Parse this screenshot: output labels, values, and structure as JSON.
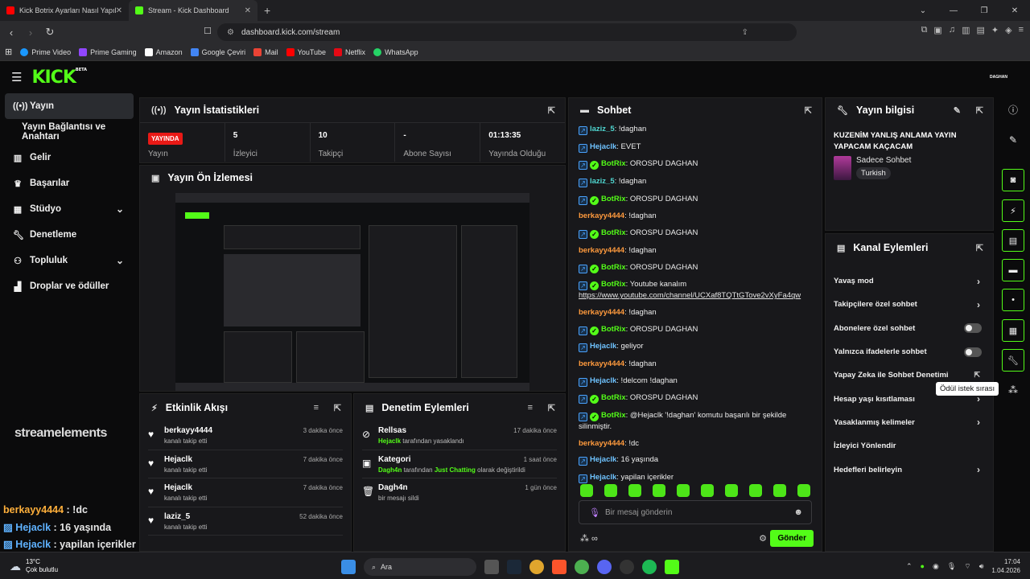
{
  "browser": {
    "tabs": [
      {
        "title": "Kick Botrix Ayarları Nasıl Yapılır? Takip",
        "favicon_color": "#ff0000"
      },
      {
        "title": "Stream - Kick Dashboard",
        "favicon_color": "#53fc18"
      }
    ],
    "url": "dashboard.kick.com/stream",
    "bookmarks": [
      "Prime Video",
      "Prime Gaming",
      "Amazon",
      "Google Çeviri",
      "Mail",
      "YouTube",
      "Netflix",
      "WhatsApp"
    ]
  },
  "header": {
    "logo": "KICK",
    "logo_badge": "BETA",
    "user": "DAGHAN"
  },
  "sidebar": {
    "items": [
      {
        "label": "Yayın",
        "icon": "broadcast-icon"
      },
      {
        "label": "Yayın Bağlantısı ve Anahtarı",
        "icon": ""
      },
      {
        "label": "Gelir",
        "icon": "chart-icon"
      },
      {
        "label": "Başarılar",
        "icon": "trophy-icon"
      },
      {
        "label": "Stüdyo",
        "icon": "studio-icon"
      },
      {
        "label": "Denetleme",
        "icon": "wrench-icon"
      },
      {
        "label": "Topluluk",
        "icon": "community-icon"
      },
      {
        "label": "Droplar ve ödüller",
        "icon": "gift-icon"
      }
    ],
    "watermark": "streamelements"
  },
  "overlay_chat": [
    {
      "user": "berkayy4444",
      "text": " : !dc"
    },
    {
      "user": "Hejaclk",
      "text": " : 16 yaşında"
    },
    {
      "user": "Hejaclk",
      "text": " : yapilan içerikler"
    }
  ],
  "stats": {
    "title": "Yayın İstatistikleri",
    "live": "YAYINDA",
    "live_label": "Yayın",
    "items": [
      {
        "value": "5",
        "label": "İzleyici"
      },
      {
        "value": "10",
        "label": "Takipçi"
      },
      {
        "value": "-",
        "label": "Abone Sayısı"
      },
      {
        "value": "01:13:35",
        "label": "Yayında Olduğu"
      }
    ]
  },
  "preview": {
    "title": "Yayın Ön İzlemesi"
  },
  "activity": {
    "title": "Etkinlik Akışı",
    "items": [
      {
        "user": "berkayy4444",
        "desc": "kanalı takip etti",
        "time": "3 dakika önce"
      },
      {
        "user": "Hejaclk",
        "desc": "kanalı takip etti",
        "time": "7 dakika önce"
      },
      {
        "user": "Hejaclk",
        "desc": "kanalı takip etti",
        "time": "7 dakika önce"
      },
      {
        "user": "laziz_5",
        "desc": "kanalı takip etti",
        "time": "52 dakika önce"
      }
    ]
  },
  "moderation": {
    "title": "Denetim Eylemleri",
    "items": [
      {
        "title": "Rellsas",
        "actor": "Hejaclk",
        "desc": " tarafından yasaklandı",
        "time": "17 dakika önce"
      },
      {
        "title": "Kategori",
        "actor": "Dagh4n",
        "mid": " tarafından ",
        "target": "Just Chatting",
        "desc": " olarak değiştirildi",
        "time": "1 saat önce"
      },
      {
        "title": "Dagh4n",
        "actor": "",
        "desc": "bir mesajı sildi",
        "time": "1 gün önce"
      }
    ]
  },
  "chat": {
    "title": "Sohbet",
    "messages": [
      {
        "user": "laziz_5",
        "cls": "n-cy",
        "badge": "bx",
        "text": ": !daghan"
      },
      {
        "user": "Hejaclk",
        "cls": "n-blue",
        "badge": "bx",
        "text": ": EVET"
      },
      {
        "user": "BotRix",
        "cls": "n-bot",
        "badge": "bot",
        "text": ": OROSPU DAGHAN"
      },
      {
        "user": "laziz_5",
        "cls": "n-cy",
        "badge": "bx",
        "text": ": !daghan"
      },
      {
        "user": "BotRix",
        "cls": "n-bot",
        "badge": "bot",
        "text": ": OROSPU DAGHAN"
      },
      {
        "user": "berkayy4444",
        "cls": "n-or",
        "badge": "",
        "text": ": !daghan"
      },
      {
        "user": "BotRix",
        "cls": "n-bot",
        "badge": "bot",
        "text": ": OROSPU DAGHAN"
      },
      {
        "user": "berkayy4444",
        "cls": "n-or",
        "badge": "",
        "text": ": !daghan"
      },
      {
        "user": "BotRix",
        "cls": "n-bot",
        "badge": "bot",
        "text": ": OROSPU DAGHAN"
      },
      {
        "user": "BotRix",
        "cls": "n-bot",
        "badge": "bot",
        "text": ": Youtube kanalım ",
        "link": "https://www.youtube.com/channel/UCXaf8TQTtGTove2vXyFa4qw"
      },
      {
        "user": "berkayy4444",
        "cls": "n-or",
        "badge": "",
        "text": ": !daghan"
      },
      {
        "user": "BotRix",
        "cls": "n-bot",
        "badge": "bot",
        "text": ": OROSPU DAGHAN"
      },
      {
        "user": "Hejaclk",
        "cls": "n-blue",
        "badge": "bx",
        "text": ": geliyor"
      },
      {
        "user": "berkayy4444",
        "cls": "n-or",
        "badge": "",
        "text": ": !daghan"
      },
      {
        "user": "Hejaclk",
        "cls": "n-blue",
        "badge": "bx",
        "text": ": !delcom !daghan"
      },
      {
        "user": "BotRix",
        "cls": "n-bot",
        "badge": "bot",
        "text": ": OROSPU DAGHAN"
      },
      {
        "user": "BotRix",
        "cls": "n-bot",
        "badge": "bot",
        "text": ": @Hejaclk '!daghan' komutu başarılı bir şekilde silinmiştir."
      },
      {
        "user": "berkayy4444",
        "cls": "n-or",
        "badge": "",
        "text": ": !dc"
      },
      {
        "user": "Hejaclk",
        "cls": "n-blue",
        "badge": "bx",
        "text": ": 16 yaşında"
      },
      {
        "user": "Hejaclk",
        "cls": "n-blue",
        "badge": "bx",
        "text": ": yapilan içerikler"
      }
    ],
    "placeholder": "Bir mesaj gönderin",
    "send": "Gönder"
  },
  "info": {
    "title": "Yayın bilgisi",
    "stream_title": "KUZENİM YANLIŞ ANLAMA YAYIN YAPACAM KAÇACAM",
    "category": "Sadece Sohbet",
    "language": "Turkish"
  },
  "actions": {
    "title": "Kanal Eylemleri",
    "items": [
      {
        "label": "Yavaş mod",
        "control": "arrow"
      },
      {
        "label": "Takipçilere özel sohbet",
        "control": "arrow"
      },
      {
        "label": "Abonelere özel sohbet",
        "control": "toggle",
        "value": false
      },
      {
        "label": "Yalnızca ifadelerle sohbet",
        "control": "toggle",
        "value": false
      },
      {
        "label": "Yapay Zeka ile Sohbet Denetimi",
        "control": "external"
      },
      {
        "label": "Hesap yaşı kısıtlaması",
        "control": "arrow"
      },
      {
        "label": "Yasaklanmış kelimeler",
        "control": "arrow"
      },
      {
        "label": "İzleyici Yönlendir",
        "control": "none"
      },
      {
        "label": "Hedefleri belirleyin",
        "control": "arrow"
      }
    ]
  },
  "tooltip": "Ödül istek sırası",
  "taskbar": {
    "temp": "13°C",
    "weather": "Çok bulutlu",
    "search": "Ara",
    "time": "17:04",
    "date": "1.04.2026"
  },
  "colors": {
    "accent": "#53fc18",
    "live": "#e91916",
    "bg": "#0b0b0c",
    "panel": "#18181b"
  }
}
